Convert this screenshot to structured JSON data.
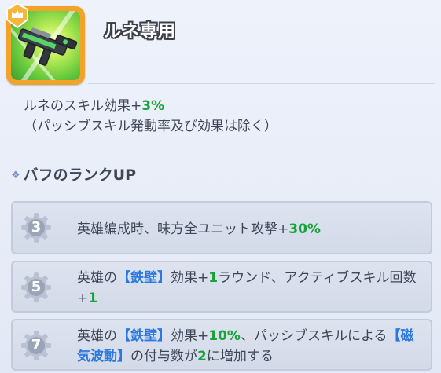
{
  "header": {
    "title": "ルネ専用"
  },
  "description": {
    "part1": "ルネのスキル効果+",
    "value": "3%",
    "part2": "（パッシブスキル発動率及び効果は除く）"
  },
  "section": {
    "title": "バフのランクUP"
  },
  "ranks": [
    {
      "level": "3",
      "t1": "英雄編成時、味方全ユニット攻撃+",
      "v1": "30%"
    },
    {
      "level": "5",
      "t1": "英雄の",
      "k1": "【鉄壁】",
      "t2": "効果+",
      "v1": "1",
      "t3": "ラウンド、アクティブスキル回数+",
      "v2": "1"
    },
    {
      "level": "7",
      "t1": "英雄の",
      "k1": "【鉄壁】",
      "t2": "効果+",
      "v1": "10%",
      "t3": "、パッシブスキルによる",
      "k2": "【磁気波動】",
      "t4": "の付与数が",
      "v2": "2",
      "t5": "に増加する"
    }
  ],
  "colors": {
    "value_green": "#18a33a",
    "keyword_blue": "#2a78e0",
    "frame_orange": "#f3a32a"
  },
  "icons": {
    "weapon": "rifle-icon",
    "badge": "crown-badge-icon",
    "rank": "gear-icon"
  }
}
